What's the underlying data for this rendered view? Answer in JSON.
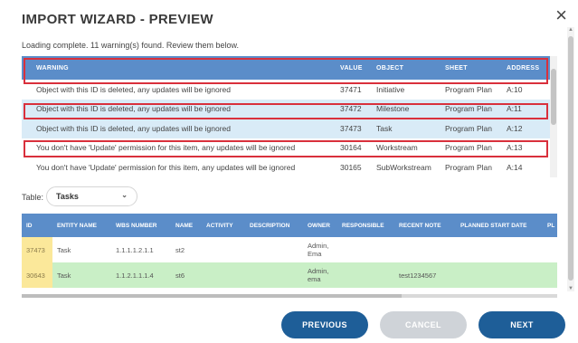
{
  "dialog": {
    "title": "IMPORT WIZARD - PREVIEW",
    "close_label": "×",
    "status": "Loading complete. 11 warning(s) found. Review them below."
  },
  "warnings": {
    "columns": [
      "WARNING",
      "VALUE",
      "OBJECT",
      "SHEET",
      "ADDRESS"
    ],
    "rows": [
      {
        "warning": "Object with this ID is deleted, any updates will be ignored",
        "value": "37471",
        "object": "Initiative",
        "sheet": "Program Plan",
        "address": "A:10"
      },
      {
        "warning": "Object with this ID is deleted, any updates will be ignored",
        "value": "37472",
        "object": "Milestone",
        "sheet": "Program Plan",
        "address": "A:11"
      },
      {
        "warning": "Object with this ID is deleted, any updates will be ignored",
        "value": "37473",
        "object": "Task",
        "sheet": "Program Plan",
        "address": "A:12"
      },
      {
        "warning": "You don't have 'Update' permission for this item, any updates will be ignored",
        "value": "30164",
        "object": "Workstream",
        "sheet": "Program Plan",
        "address": "A:13"
      },
      {
        "warning": "You don't have 'Update' permission for this item, any updates will be ignored",
        "value": "30165",
        "object": "SubWorkstream",
        "sheet": "Program Plan",
        "address": "A:14"
      }
    ]
  },
  "table_selector": {
    "label": "Table:",
    "selected": "Tasks",
    "chevron": "⌄"
  },
  "data": {
    "columns": [
      "ID",
      "ENTITY NAME",
      "WBS NUMBER",
      "NAME",
      "ACTIVITY",
      "DESCRIPTION",
      "OWNER",
      "RESPONSIBLE",
      "RECENT NOTE",
      "PLANNED START DATE",
      "PL"
    ],
    "rows": [
      {
        "id": "37473",
        "entity": "Task",
        "wbs": "1.1.1.1.2.1.1",
        "name": "st2",
        "activity": "",
        "description": "",
        "owner": "Admin, Ema",
        "responsible": "",
        "note": "",
        "planned_start": "",
        "pl": ""
      },
      {
        "id": "30643",
        "entity": "Task",
        "wbs": "1.1.2.1.1.1.4",
        "name": "st6",
        "activity": "",
        "description": "",
        "owner": "Admin, ema",
        "responsible": "",
        "note": "test1234567",
        "planned_start": "",
        "pl": ""
      }
    ]
  },
  "buttons": {
    "previous": "PREVIOUS",
    "cancel": "CANCEL",
    "next": "NEXT"
  },
  "colors": {
    "header_blue": "#5b8dc9",
    "button_blue": "#1e5e98",
    "highlight_red": "#d9303c",
    "row_alt": "#d9ebf7",
    "row_green": "#c9efc6",
    "id_yellow": "#fbe89a"
  }
}
